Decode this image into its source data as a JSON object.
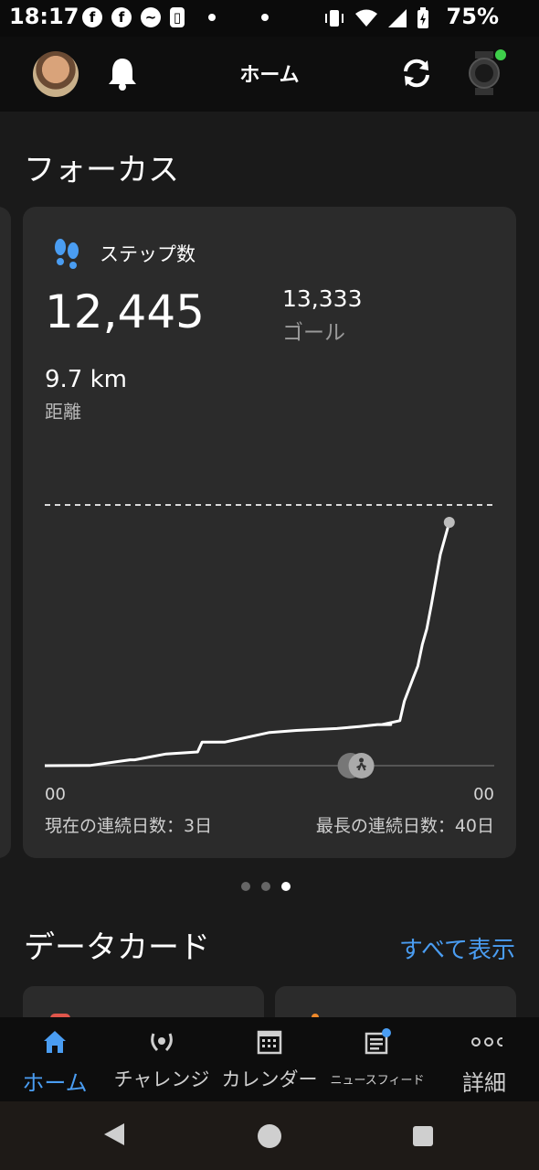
{
  "status_bar": {
    "time": "18:17",
    "battery": "75%",
    "left_icons": [
      "facebook-icon",
      "facebook-icon",
      "messenger-icon",
      "app-icon",
      "dot",
      "dot"
    ],
    "right_icons": [
      "vibrate-icon",
      "wifi-icon",
      "signal-icon",
      "battery-charging-icon"
    ]
  },
  "app_bar": {
    "title": "ホーム"
  },
  "focus": {
    "title": "フォーカス",
    "card": {
      "label": "ステップ数",
      "steps": "12,445",
      "goal_value": "13,333",
      "goal_label": "ゴール",
      "distance_value": "9.7 km",
      "distance_label": "距離",
      "axis_start": "00",
      "axis_end": "00",
      "streak_current": "現在の連続日数：3日",
      "streak_longest": "最長の連続日数：40日"
    },
    "pager": {
      "count": 3,
      "active_index": 2
    }
  },
  "chart_data": {
    "type": "line",
    "title": "",
    "xlabel": "",
    "ylabel": "",
    "x_tick_labels": [
      "00",
      "00"
    ],
    "goal_line": 13333,
    "series": [
      {
        "name": "",
        "x_fraction_of_day": [
          0,
          0.1,
          0.19,
          0.2,
          0.27,
          0.34,
          0.35,
          0.4,
          0.48,
          0.5,
          0.56,
          0.65,
          0.7,
          0.74,
          0.77,
          0.75,
          0.79,
          0.8,
          0.82,
          0.83,
          0.84,
          0.85,
          0.86,
          0.88,
          0.9
        ],
        "values": [
          0,
          10,
          300,
          300,
          600,
          700,
          1200,
          1200,
          1600,
          1700,
          1800,
          1900,
          2000,
          2100,
          2100,
          2100,
          2300,
          3300,
          4500,
          5100,
          6200,
          7000,
          8200,
          10800,
          12445
        ]
      }
    ],
    "current_value": 12445,
    "grid": false
  },
  "data_cards": {
    "title": "データカード",
    "see_all": "すべて表示"
  },
  "bottom_nav": [
    {
      "label": "ホーム",
      "icon": "home-icon",
      "active": true
    },
    {
      "label": "チャレンジ",
      "icon": "laurel-icon",
      "active": false
    },
    {
      "label": "カレンダー",
      "icon": "calendar-icon",
      "active": false
    },
    {
      "label": "ニュースフィード",
      "icon": "newsfeed-icon",
      "active": false
    },
    {
      "label": "詳細",
      "icon": "more-icon",
      "active": false
    }
  ],
  "colors": {
    "accent": "#4a9df2",
    "card": "#2b2b2b",
    "background": "#1a1a1a",
    "heart": "#e0564b",
    "orange": "#f08a2a",
    "online": "#3ecf4a"
  }
}
